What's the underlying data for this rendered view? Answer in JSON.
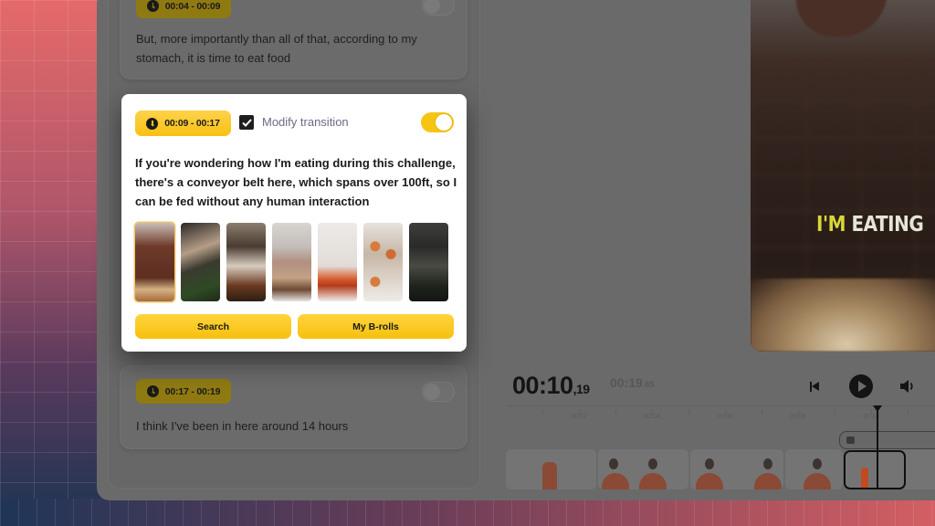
{
  "transcript": {
    "segments": [
      {
        "time_range": "00:04 - 00:09",
        "text": "But, more importantly than all of that, according to my stomach, it is time to eat food",
        "transition_enabled": false
      },
      {
        "time_range": "00:09 - 00:17",
        "text": "If you're wondering how I'm eating during this challenge, there's a conveyor belt here, which spans over 100ft, so I can be fed without any human interaction",
        "transition_enabled": true,
        "modify_transition_label": "Modify transition",
        "modify_transition_checked": true,
        "broll_thumbnails": [
          {
            "name": "cheese-grating-over-pasta",
            "selected": true
          },
          {
            "name": "knife-cutting-bread",
            "selected": false
          },
          {
            "name": "kitchen-cooking",
            "selected": false
          },
          {
            "name": "pouring-syrup-pancakes",
            "selected": false
          },
          {
            "name": "spaghetti-plate",
            "selected": false
          },
          {
            "name": "pizza-slices",
            "selected": false
          },
          {
            "name": "dark-kitchen-pan",
            "selected": false
          }
        ],
        "search_label": "Search",
        "my_brolls_label": "My B-rolls"
      },
      {
        "time_range": "00:17 - 00:19",
        "text": "I think I've been in here around 14 hours",
        "transition_enabled": false
      }
    ]
  },
  "preview": {
    "caption_highlight": "I'M",
    "caption_rest": "EATING"
  },
  "player": {
    "current_time": "00:10",
    "current_time_frac": ",19",
    "total_time": "00:19",
    "total_time_frac": ".65",
    "ruler_ticks": [
      "00:02",
      "00:04",
      "00:06",
      "00:08",
      "00:10"
    ]
  },
  "colors": {
    "accent": "#f7c112",
    "overlay_dim": "#6a6a6a"
  }
}
